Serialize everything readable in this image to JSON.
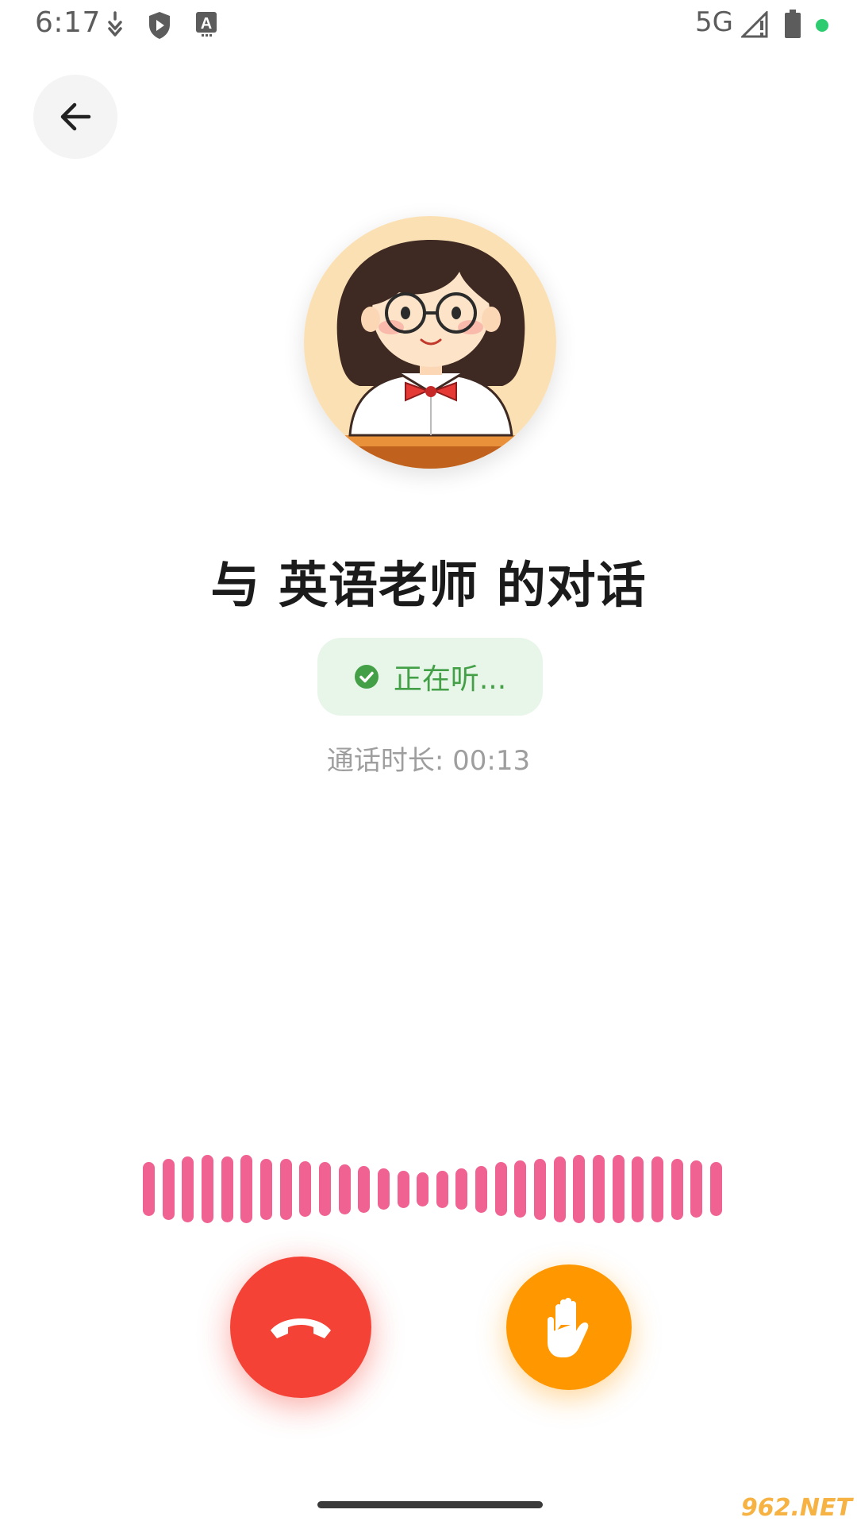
{
  "status_bar": {
    "time": "6:17",
    "network": "5G"
  },
  "header": {
    "back_icon": "arrow-left-icon"
  },
  "call": {
    "avatar_description_icon": "teacher-avatar",
    "title": "与 英语老师 的对话",
    "status_text": "正在听...",
    "status_icon": "check-circle-icon",
    "duration": "通话时长: 00:13"
  },
  "waveform": {
    "levels": [
      0.75,
      0.85,
      0.92,
      0.96,
      0.92,
      0.96,
      0.85,
      0.85,
      0.78,
      0.75,
      0.7,
      0.66,
      0.58,
      0.52,
      0.48,
      0.52,
      0.58,
      0.66,
      0.75,
      0.8,
      0.85,
      0.92,
      0.96,
      0.96,
      0.96,
      0.92,
      0.92,
      0.85,
      0.8,
      0.75
    ]
  },
  "controls": {
    "hangup_icon": "phone-hangup-icon",
    "raise_hand_icon": "raise-hand-icon"
  },
  "colors": {
    "accent_green": "#43a047",
    "pill_bg": "#e8f5e9",
    "wave": "#f06292",
    "hangup": "#f44336",
    "raise": "#ff9800"
  },
  "watermark": "962.NET"
}
